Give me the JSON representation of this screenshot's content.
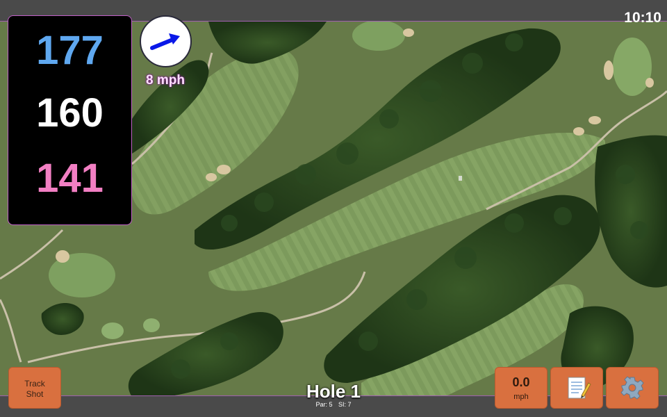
{
  "status": {
    "time": "10:10"
  },
  "distances": {
    "back": "177",
    "middle": "160",
    "front": "141"
  },
  "wind": {
    "speed": "8 mph",
    "icon": "wind-arrow-icon"
  },
  "hole": {
    "title": "Hole 1",
    "par": "Par: 5",
    "stroke_index": "SI: 7"
  },
  "buttons": {
    "track_shot": {
      "line1": "Track",
      "line2": "Shot"
    },
    "speed": {
      "value": "0.0",
      "unit": "mph"
    },
    "notes": {
      "icon": "notepad-icon"
    },
    "settings": {
      "icon": "gear-icon"
    }
  },
  "colors": {
    "back": "#5fa8f0",
    "middle": "#ffffff",
    "front": "#f27fc3",
    "button": "#d9703f",
    "panel_border": "#c060c8"
  }
}
